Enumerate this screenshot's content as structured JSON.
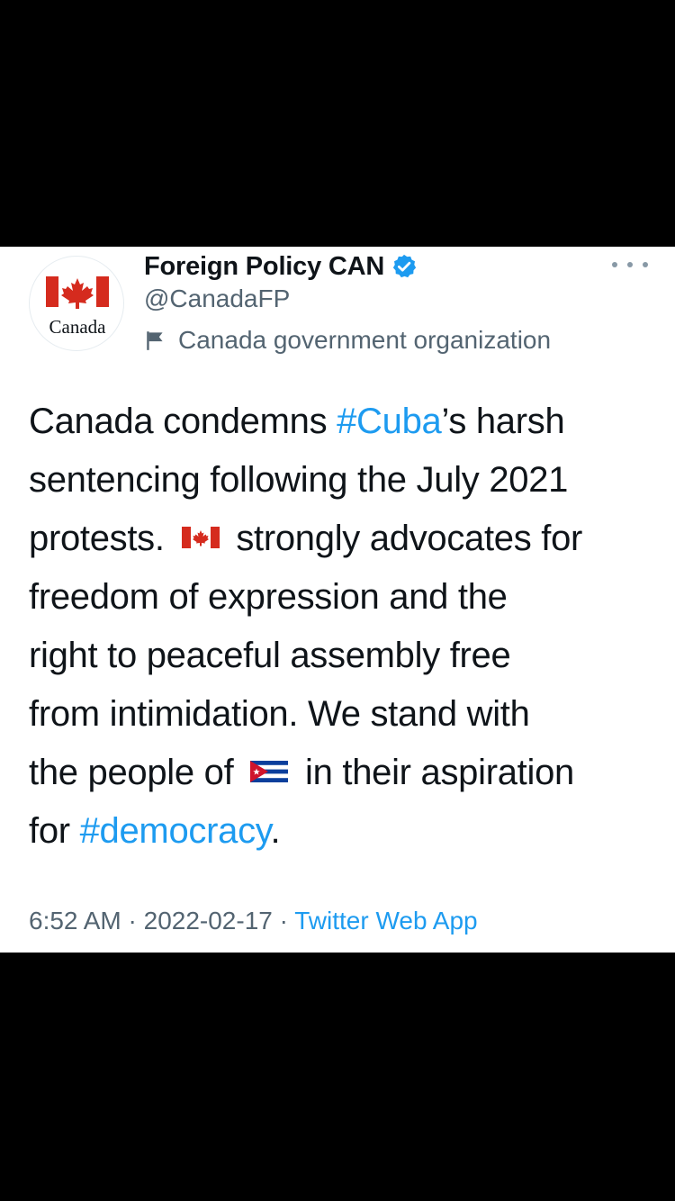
{
  "author": {
    "display_name": "Foreign Policy CAN",
    "handle": "@CanadaFP",
    "label": "Canada government organization",
    "avatar_wordmark": "Canada",
    "verified": true
  },
  "tweet": {
    "lines": [
      [
        {
          "t": "Canada condemns "
        },
        {
          "t": "#Cuba",
          "link": true
        },
        {
          "t": "’s harsh"
        }
      ],
      [
        {
          "t": "sentencing following the July 2021"
        }
      ],
      [
        {
          "t": "protests. "
        },
        {
          "emoji": "canada-flag"
        },
        {
          "t": " strongly advocates for"
        }
      ],
      [
        {
          "t": "freedom of expression and the"
        }
      ],
      [
        {
          "t": "right to peaceful assembly free"
        }
      ],
      [
        {
          "t": "from intimidation. We stand with"
        }
      ],
      [
        {
          "t": "the people of "
        },
        {
          "emoji": "cuba-flag"
        },
        {
          "t": " in their aspiration"
        }
      ],
      [
        {
          "t": "for "
        },
        {
          "t": "#democracy",
          "link": true
        },
        {
          "t": "."
        }
      ]
    ]
  },
  "meta": {
    "time": "6:52 AM",
    "separator": " · ",
    "date": "2022-02-17",
    "source": "Twitter Web App"
  },
  "colors": {
    "link": "#1d9bf0",
    "verified": "#1d9bf0",
    "canada_red": "#d52b1e",
    "secondary_text": "#536471"
  }
}
